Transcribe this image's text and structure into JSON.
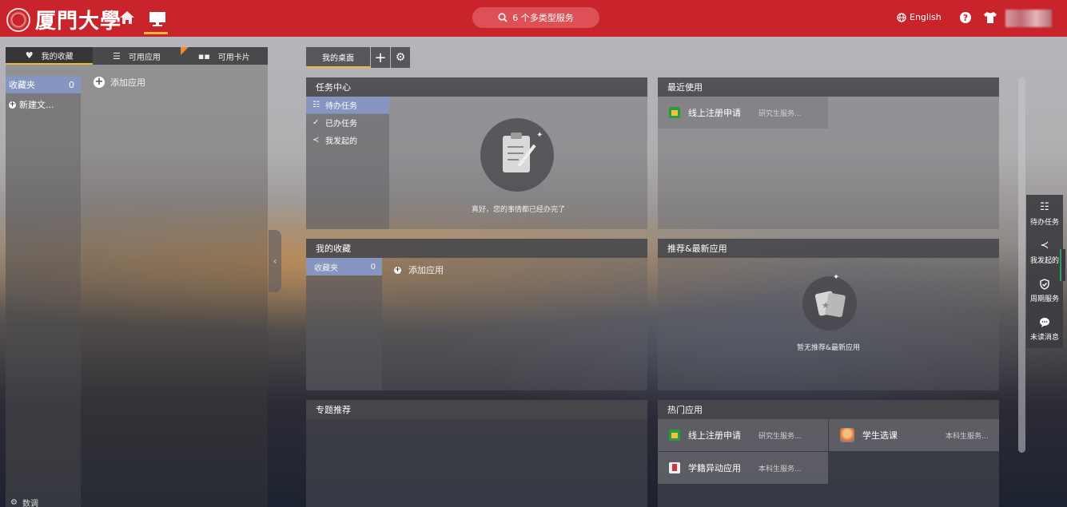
{
  "header": {
    "logo_text": "厦門大學",
    "search_label": "6 个多类型服务",
    "language_label": "English"
  },
  "left_panel": {
    "tabs": [
      {
        "label": "我的收藏"
      },
      {
        "label": "可用应用"
      },
      {
        "label": "可用卡片"
      }
    ],
    "folder": {
      "label": "收藏夹",
      "count": "0"
    },
    "new_folder_label": "新建文...",
    "add_app_label": "添加应用",
    "settings_label": "数调"
  },
  "desk": {
    "tab_label": "我的桌面",
    "add_symbol": "+",
    "gear_symbol": "⚙"
  },
  "task_center": {
    "title": "任务中心",
    "items": [
      {
        "label": "待办任务",
        "icon": "list-icon"
      },
      {
        "label": "已办任务",
        "icon": "check-icon"
      },
      {
        "label": "我发起的",
        "icon": "share-icon"
      }
    ],
    "empty_message": "真好，您的事情都已经办完了"
  },
  "recent": {
    "title": "最近使用",
    "items": [
      {
        "name": "线上注册申请",
        "category": "研究生服务..."
      }
    ]
  },
  "favorites": {
    "title": "我的收藏",
    "folder_label": "收藏夹",
    "folder_count": "0",
    "add_label": "添加应用"
  },
  "recommend": {
    "title": "推荐&最新应用",
    "empty_message": "暂无推荐&最新应用"
  },
  "topics": {
    "title": "专题推荐"
  },
  "hot_apps": {
    "title": "热门应用",
    "items": [
      {
        "name": "线上注册申请",
        "category": "研究生服务..."
      },
      {
        "name": "学生选课",
        "category": "本科生服务..."
      },
      {
        "name": "学籍异动应用",
        "category": "本科生服务..."
      }
    ]
  },
  "float_bar": {
    "items": [
      {
        "label": "待办任务",
        "icon": "list-icon"
      },
      {
        "label": "我发起的",
        "icon": "share-icon"
      },
      {
        "label": "周期服务",
        "icon": "shield-check-icon"
      },
      {
        "label": "未读消息",
        "icon": "chat-icon"
      }
    ]
  },
  "colors": {
    "header_red": "#c9242b",
    "accent_yellow": "#f0b640",
    "selected_blue": "#8696c0"
  }
}
